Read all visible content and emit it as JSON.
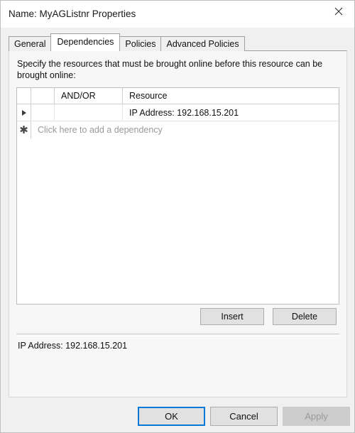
{
  "window": {
    "title": "Name: MyAGListnr Properties",
    "close_icon": "close-icon"
  },
  "tabs": [
    {
      "label": "General",
      "active": false
    },
    {
      "label": "Dependencies",
      "active": true
    },
    {
      "label": "Policies",
      "active": false
    },
    {
      "label": "Advanced Policies",
      "active": false
    }
  ],
  "panel": {
    "instruction": "Specify the resources that must be brought online before this resource can be brought online:"
  },
  "grid": {
    "columns": [
      "",
      "",
      "AND/OR",
      "Resource"
    ],
    "rows": [
      {
        "marker": "current-row-arrow",
        "and_or": "",
        "resource": "IP Address: 192.168.15.201"
      }
    ],
    "new_row": {
      "marker": "new-row-asterisk",
      "placeholder": "Click here to add a dependency"
    }
  },
  "grid_buttons": {
    "insert": "Insert",
    "delete": "Delete"
  },
  "summary": {
    "text": "IP Address: 192.168.15.201"
  },
  "footer": {
    "ok": "OK",
    "cancel": "Cancel",
    "apply": "Apply"
  },
  "colors": {
    "accent": "#0078d7",
    "dialog_background": "#f0f0f0",
    "panel_background": "#f7f7f7",
    "grid_background": "#ffffff",
    "button_face": "#e1e1e1",
    "disabled_text": "#9a9a9a",
    "placeholder_text": "#9a9a9a"
  }
}
